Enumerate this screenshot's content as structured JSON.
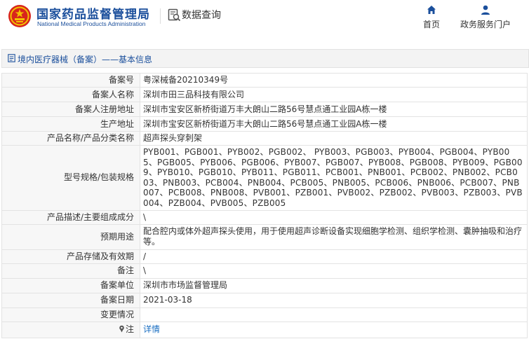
{
  "header": {
    "logo_cn": "国家药品监督管理局",
    "logo_en": "National Medical Products Administration",
    "section_title": "数据查询",
    "nav": [
      {
        "label": "首页",
        "icon": "home-icon"
      },
      {
        "label": "政务服务门户",
        "icon": "user-icon"
      }
    ]
  },
  "breadcrumb": {
    "text": "境内医疗器械（备案）——基本信息",
    "icon": "document-icon"
  },
  "record": {
    "rows": [
      {
        "label": "备案号",
        "value": "粤深械备20210349号"
      },
      {
        "label": "备案人名称",
        "value": "深圳市田三品科技有限公司"
      },
      {
        "label": "备案人注册地址",
        "value": "深圳市宝安区新桥街道万丰大朗山二路56号慧点通工业园A栋一楼"
      },
      {
        "label": "生产地址",
        "value": "深圳市宝安区新桥街道万丰大朗山二路56号慧点通工业园A栋一楼"
      },
      {
        "label": "产品名称/产品分类名称",
        "value": "超声探头穿刺架"
      },
      {
        "label": "型号规格/包装规格",
        "value": "PYB001、PGB001、PYB002、PGB002、 PYB003、PGB003、PYB004、PGB004、PYB005、PGB005、PYB006、PGB006、PYB007、PGB007、PYB008、PGB008、PYB009、PGB009、PYB010、PGB010、PYB011、PGB011、PCB001、PNB001、PCB002、PNB002、PCB003、PNB003、PCB004、PNB004、PCB005、PNB005、PCB006、PNB006、PCB007、PNB007、PCB008、PNB008、PVB001、PZB001、PVB002、PZB002、PVB003、PZB003、PVB004、PZB004、PVB005、PZB005"
      },
      {
        "label": "产品描述/主要组成成分",
        "value": "\\"
      },
      {
        "label": "预期用途",
        "value": "配合腔内或体外超声探头使用，用于使用超声诊断设备实现细胞学检测、组织学检测、囊肿抽吸和治疗等。"
      },
      {
        "label": "产品存储及有效期",
        "value": "/"
      },
      {
        "label": "备注",
        "value": "\\"
      },
      {
        "label": "备案单位",
        "value": "深圳市市场监督管理局"
      },
      {
        "label": "备案日期",
        "value": "2021-03-18"
      },
      {
        "label": "变更情况",
        "value": ""
      }
    ],
    "note_row": {
      "label": "注",
      "link": "详情",
      "icon": "pin-icon"
    }
  }
}
